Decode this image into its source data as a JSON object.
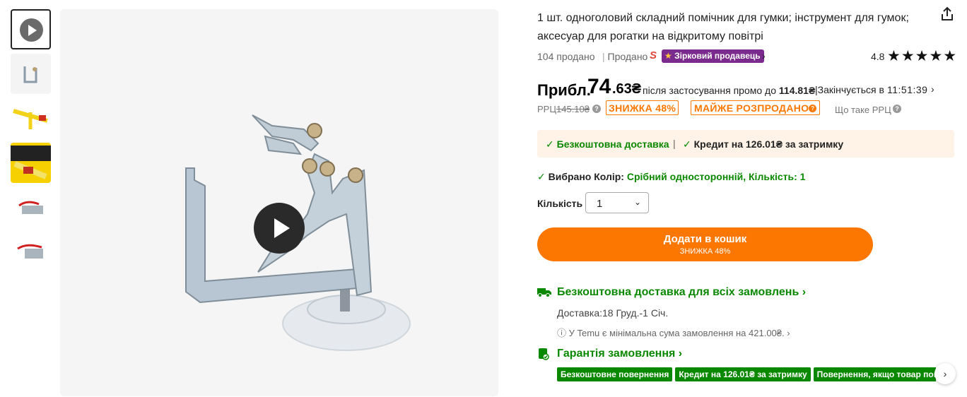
{
  "product": {
    "title": "1 шт. одноголовий складний помічник для гумки; інструмент для гумок; аксесуар для рогатки на відкритому повітрі",
    "sold": "104 продано",
    "sold_by": "Продано",
    "seller_logo": "S",
    "star_seller_label": "Зірковий продавець",
    "rating": "4.8",
    "stars": "★★★★★"
  },
  "price": {
    "approx_label": "Прибл.",
    "main": "74",
    "fraction": ".63₴",
    "after_promo_prefix": "після застосування промо до ",
    "after_promo_value": "114.81₴",
    "ends_label": "Закінчується в",
    "timer": "11:51:39",
    "rrp_label": "РРЦ",
    "rrp_value": "145.10₴",
    "discount_badge": "ЗНИЖКА 48%",
    "almost_sold_badge": "МАЙЖЕ РОЗПРОДАНО",
    "what_is_rrp": "Що таке РРЦ"
  },
  "delivery_box": {
    "free_shipping": "Безкоштовна доставка",
    "separator": "|",
    "credit": "Кредит на 126.01₴ за затримку"
  },
  "selection": {
    "label": "Вибрано Колір:",
    "value": "Срібний односторонній, Кількість: 1"
  },
  "quantity": {
    "label": "Кількість",
    "value": "1"
  },
  "cart_button": {
    "label": "Додати в кошик",
    "sub": "ЗНИЖКА 48%"
  },
  "shipping": {
    "title": "Безкоштовна доставка для всіх замовлень",
    "delivery_label": "Доставка:",
    "delivery_dates": "18 Груд.-1 Січ.",
    "min_order": "ⓘ У Temu є мінімальна сума замовлення на 421.00₴."
  },
  "guarantee": {
    "title": "Гарантія замовлення",
    "tags": [
      "Безкоштовне повернення",
      "Кредит на 126.01₴ за затримку",
      "Повернення, якщо товар пошкоджено"
    ]
  },
  "colors": {
    "accent": "#fb7701",
    "green": "#0a8800",
    "star_badge": "#7b2a8e"
  }
}
